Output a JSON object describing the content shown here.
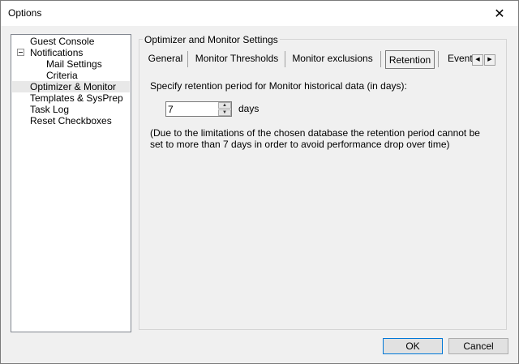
{
  "window": {
    "title": "Options",
    "close_glyph": "✕"
  },
  "tree": {
    "items": [
      {
        "label": "Guest Console"
      },
      {
        "label": "Notifications"
      },
      {
        "label": "Mail Settings"
      },
      {
        "label": "Criteria"
      },
      {
        "label": "Optimizer & Monitor"
      },
      {
        "label": "Templates & SysPrep"
      },
      {
        "label": "Task Log"
      },
      {
        "label": "Reset Checkboxes"
      }
    ]
  },
  "panel": {
    "group_title": "Optimizer and Monitor Settings",
    "tabs": [
      {
        "label": "General"
      },
      {
        "label": "Monitor Thresholds"
      },
      {
        "label": "Monitor exclusions"
      },
      {
        "label": "Retention"
      },
      {
        "label": "Event"
      }
    ],
    "scroll_left": "◀",
    "scroll_right": "▶",
    "retention_prompt": "Specify retention period for Monitor historical data (in days):",
    "retention_value": "7",
    "days_label": "days",
    "spin_up": "▲",
    "spin_down": "▼",
    "note_line1": "(Due to the limitations of the chosen database the retention period cannot be",
    "note_line2": "set to more than 7 days in order to avoid performance drop over time)"
  },
  "buttons": {
    "ok": "OK",
    "cancel": "Cancel"
  }
}
